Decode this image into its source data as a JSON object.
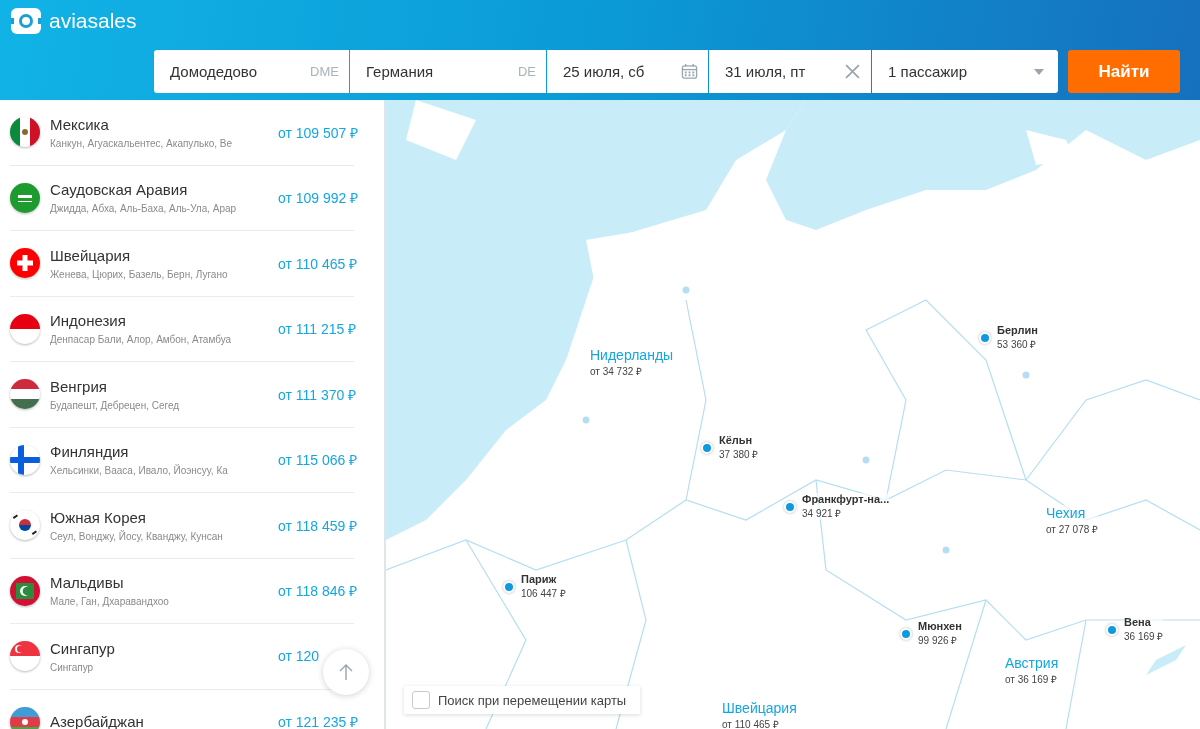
{
  "header": {
    "logo": "aviasales"
  },
  "search": {
    "origin": {
      "value": "Домодедово",
      "code": "DME"
    },
    "destination": {
      "value": "Германия",
      "code": "DE"
    },
    "depart": {
      "value": "25 июля, сб"
    },
    "return": {
      "value": "31 июля, пт"
    },
    "passengers": {
      "value": "1 пассажир"
    },
    "submit": "Найти"
  },
  "destinations": [
    {
      "name": "Мексика",
      "cities": "Канкун, Агуаскальентес, Акапулько, Ве",
      "price": "от 109 507 ₽"
    },
    {
      "name": "Саудовская Аравия",
      "cities": "Джидда, Абха, Аль-Баха, Аль-Ула, Арар",
      "price": "от 109 992 ₽"
    },
    {
      "name": "Швейцария",
      "cities": "Женева, Цюрих, Базель, Берн, Лугано",
      "price": "от 110 465 ₽"
    },
    {
      "name": "Индонезия",
      "cities": "Денпасар Бали, Алор, Амбон, Атамбуа",
      "price": "от 111 215 ₽"
    },
    {
      "name": "Венгрия",
      "cities": "Будапешт, Дебрецен, Сегед",
      "price": "от 111 370 ₽"
    },
    {
      "name": "Финляндия",
      "cities": "Хельсинки, Вааса, Ивало, Йоэнсуу, Ка",
      "price": "от 115 066 ₽"
    },
    {
      "name": "Южная Корея",
      "cities": "Сеул, Вонджу, Йосу, Кванджу, Кунсан",
      "price": "от 118 459 ₽"
    },
    {
      "name": "Мальдивы",
      "cities": "Мале, Ган, Дхаравандхоо",
      "price": "от 118 846 ₽"
    },
    {
      "name": "Сингапур",
      "cities": "Сингапур",
      "price": "от 120"
    },
    {
      "name": "Азербайджан",
      "price": "от 121 235 ₽"
    }
  ],
  "map": {
    "markers": [
      {
        "kind": "country",
        "name": "Нидерланды",
        "price": "от 34 732 ₽"
      },
      {
        "kind": "city",
        "name": "Берлин",
        "price": "53 360 ₽"
      },
      {
        "kind": "city",
        "name": "Кёльн",
        "price": "37 380 ₽"
      },
      {
        "kind": "city",
        "name": "Франкфурт-на...",
        "price": "34 921 ₽"
      },
      {
        "kind": "country",
        "name": "Чехия",
        "price": "от 27 078 ₽"
      },
      {
        "kind": "city",
        "name": "Париж",
        "price": "106 447 ₽"
      },
      {
        "kind": "city",
        "name": "Мюнхен",
        "price": "99 926 ₽"
      },
      {
        "kind": "city",
        "name": "Вена",
        "price": "36 169 ₽"
      },
      {
        "kind": "country",
        "name": "Австрия",
        "price": "от 36 169 ₽"
      },
      {
        "kind": "country",
        "name": "Швейцария",
        "price": "от 110 465 ₽"
      }
    ],
    "search_on_move": {
      "label": "Поиск при перемещении карты",
      "checked": false
    }
  }
}
